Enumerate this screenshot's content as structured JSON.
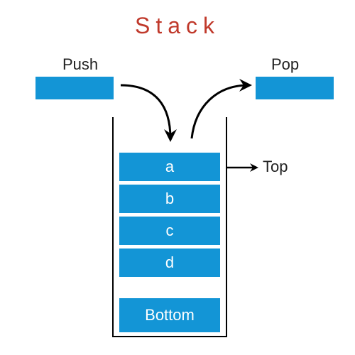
{
  "title": "Stack",
  "operations": {
    "push": "Push",
    "pop": "Pop"
  },
  "pointer": {
    "top": "Top"
  },
  "cells": [
    "a",
    "b",
    "c",
    "d",
    "Bottom"
  ],
  "colors": {
    "accent": "#1395d6",
    "title": "#c0392b"
  }
}
